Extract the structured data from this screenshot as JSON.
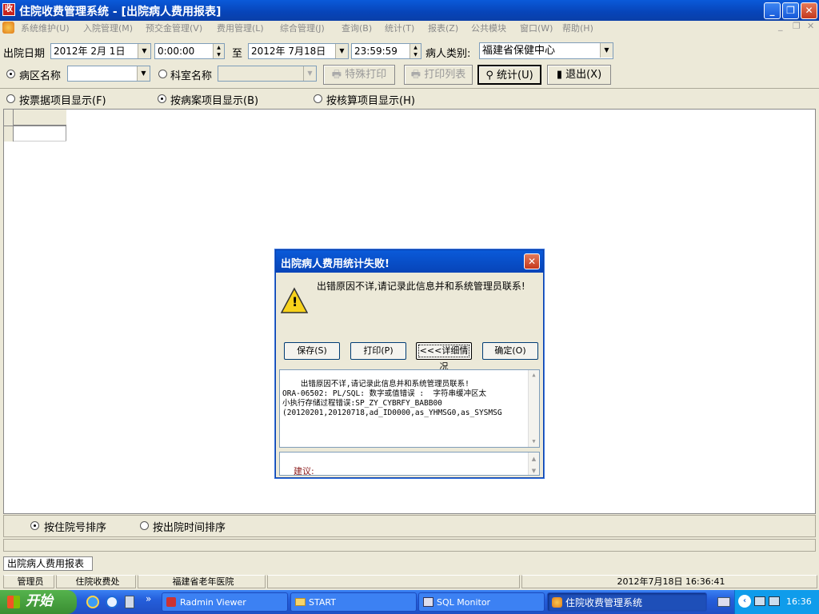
{
  "window": {
    "title": "住院收费管理系统 - [出院病人费用报表]",
    "app_icon_glyph": "收",
    "minimize_glyph": "_",
    "restore_glyph": "❐",
    "close_glyph": "✕"
  },
  "menubar": {
    "items": [
      "系统维护(U)",
      "入院管理(M)",
      "预交金管理(V)",
      "费用管理(L)",
      "综合管理(J)",
      "查询(B)",
      "统计(T)",
      "报表(Z)",
      "公共模块",
      "窗口(W)",
      "帮助(H)"
    ],
    "mdi_controls": [
      "_",
      "❐",
      "✕"
    ]
  },
  "filters": {
    "discharge_date_label": "出院日期",
    "date_from": "2012年 2月 1日",
    "time_from": "0:00:00",
    "to_label": "至",
    "date_to": "2012年 7月18日",
    "time_to": "23:59:59",
    "patient_type_label": "病人类别:",
    "patient_type_value": "福建省保健中心",
    "ward_label": "病区名称",
    "ward_value": "",
    "dept_label": "科室名称",
    "dept_value": ""
  },
  "toolbar": {
    "special_print": "特殊打印",
    "print_list": "打印列表",
    "stats": "统计(U)",
    "exit": "退出(X)"
  },
  "display_modes": {
    "by_receipt": "按票据项目显示(F)",
    "by_case": "按病案项目显示(B)",
    "by_accounting": "按核算项目显示(H)",
    "selected": "by_case"
  },
  "sort": {
    "by_admission_no": "按住院号排序",
    "by_discharge_time": "按出院时间排序",
    "selected": "by_admission_no"
  },
  "tab": {
    "label": "出院病人费用报表"
  },
  "dialog": {
    "title": "出院病人费用统计失败!",
    "message": "出错原因不详,请记录此信息并和系统管理员联系!",
    "warning_glyph": "!",
    "buttons": {
      "save": "保存(S)",
      "print": "打印(P)",
      "details": "<<<详细情况",
      "ok": "确定(O)"
    },
    "details_text": "出错原因不详,请记录此信息并和系统管理员联系!\nORA-06502: PL/SQL: 数字或值错误 :  字符串缓冲区太\n小执行存储过程错误:SP_ZY_CYBRFY_BABB00\n(20120201,20120718,ad_ID0000,as_YHMSG0,as_SYSMSG",
    "suggestion_label": "建议:"
  },
  "statusbar": {
    "user": "管理员",
    "dept": "住院收费处",
    "hospital": "福建省老年医院",
    "datetime": "2012年7月18日  16:36:41"
  },
  "taskbar": {
    "start": "开始",
    "tasks": [
      "Radmin Viewer",
      "START",
      "SQL Monitor",
      "住院收费管理系统"
    ],
    "clock": "16:36",
    "quick_launch_more": "»"
  },
  "colors": {
    "title_blue": "#0a5ad9",
    "face": "#ece9d8",
    "start_green": "#3a8e32",
    "warning_yellow": "#f7d21b"
  }
}
